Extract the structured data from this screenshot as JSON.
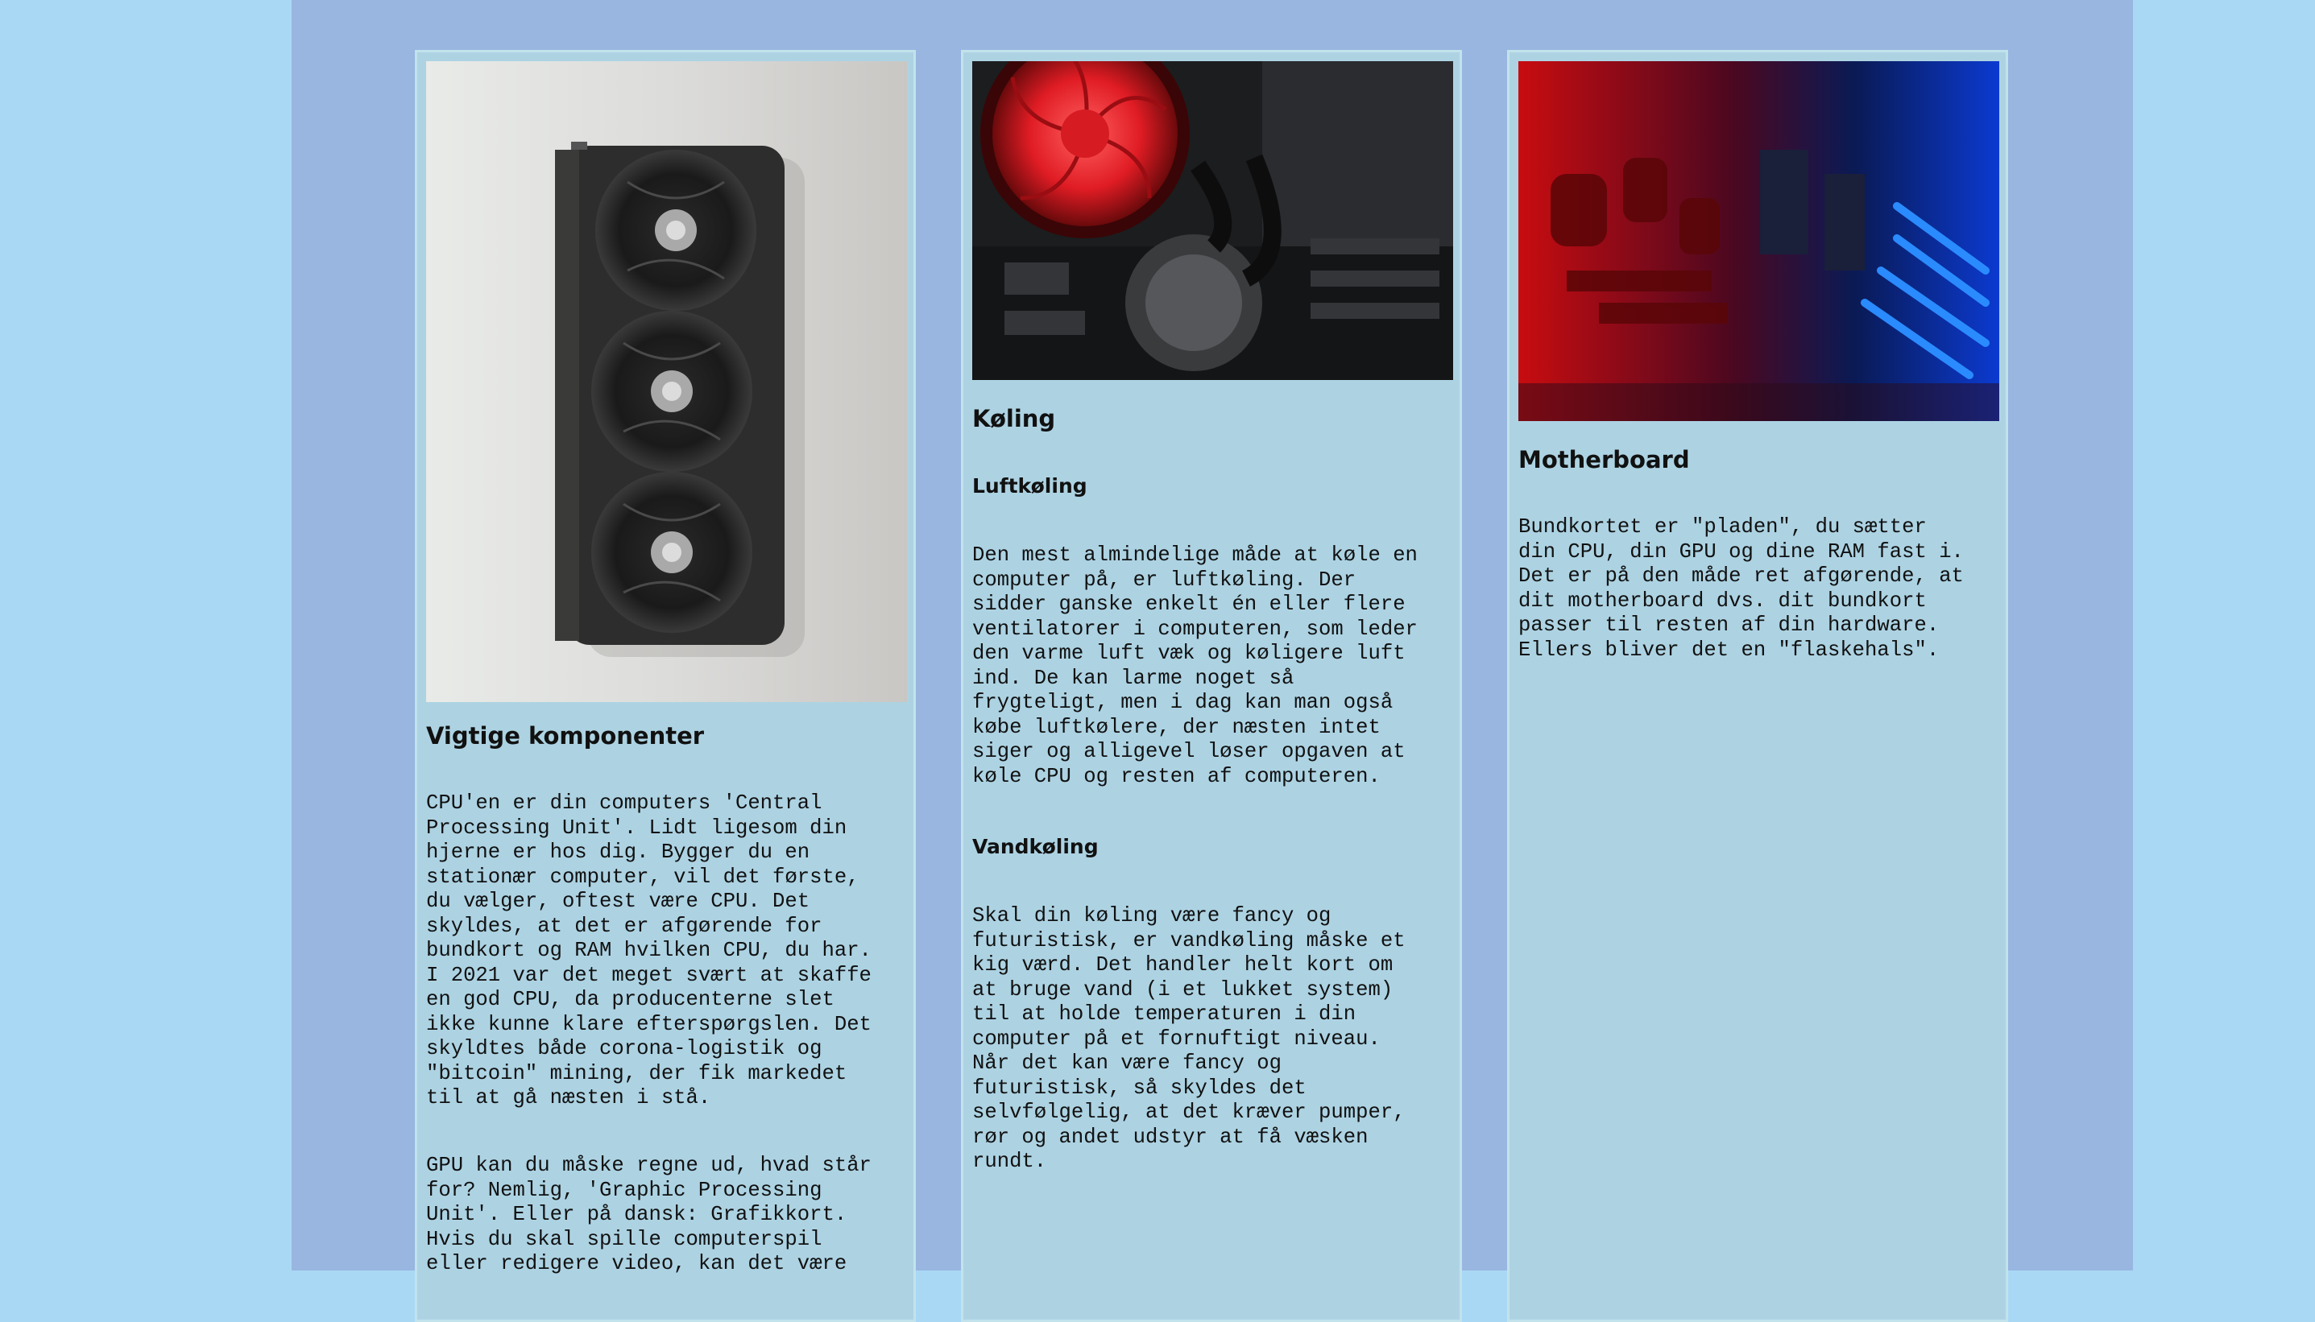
{
  "cards": [
    {
      "heading": "Vigtige komponenter",
      "paragraphs": [
        "CPU'en er din computers 'Central\nProcessing Unit'. Lidt ligesom din\nhjerne er hos dig. Bygger du en\nstationær computer, vil det første,\ndu vælger, oftest være CPU. Det\nskyldes, at det er afgørende for\nbundkort og RAM hvilken CPU, du har.\nI 2021 var det meget svært at skaffe\nen god CPU, da producenterne slet\nikke kunne klare efterspørgslen. Det\nskyldtes både corona-logistik og\n\"bitcoin\" mining, der fik markedet\ntil at gå næsten i stå.",
        "GPU kan du måske regne ud, hvad står\nfor? Nemlig, 'Graphic Processing\nUnit'. Eller på dansk: Grafikkort.\nHvis du skal spille computerspil\neller redigere video, kan det være"
      ]
    },
    {
      "heading": "Køling",
      "subsections": [
        {
          "title": "Luftkøling",
          "text": "Den mest almindelige måde at køle en\ncomputer på, er luftkøling. Der\nsidder ganske enkelt én eller flere\nventilatorer i computeren, som leder\nden varme luft væk og køligere luft\nind. De kan larme noget så\nfrygteligt, men i dag kan man også\nkøbe luftkølere, der næsten intet\nsiger og alligevel løser opgaven at\nkøle CPU og resten af computeren."
        },
        {
          "title": "Vandkøling",
          "text": "Skal din køling være fancy og\nfuturistisk, er vandkøling måske et\nkig værd. Det handler helt kort om\nat bruge vand (i et lukket system)\ntil at holde temperaturen i din\ncomputer på et fornuftigt niveau.\nNår det kan være fancy og\nfuturistisk, så skyldes det\nselvfølgelig, at det kræver pumper,\nrør og andet udstyr at få væsken\nrundt."
        }
      ]
    },
    {
      "heading": "Motherboard",
      "paragraphs": [
        "Bundkortet er \"pladen\", du sætter\ndin CPU, din GPU og dine RAM fast i.\nDet er på den måde ret afgørende, at\ndit motherboard dvs. dit bundkort\npasser til resten af din hardware.\nEllers bliver det en \"flaskehals\"."
      ]
    }
  ]
}
